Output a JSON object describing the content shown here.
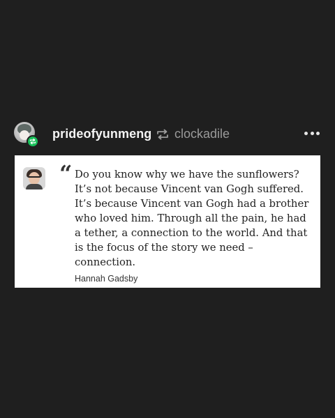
{
  "post": {
    "username": "prideofyunmeng",
    "reblogged_from": "clockadile",
    "avatar_icon": "reblog-badge-icon",
    "more_icon": "more-options-icon"
  },
  "quote": {
    "text": "Do you know why we have the sunflowers? It’s not because Vincent van Gogh suffered. It’s because Vincent van Gogh had a brother who loved him. Through all the pain, he had a tether, a connection to the world. And that is the focus of the story we need – connection.",
    "mark": "“",
    "author": "Hannah Gadsby"
  },
  "colors": {
    "background": "#1f1f1f",
    "reblog_badge": "#19c05a",
    "username": "#f4f4f4",
    "source": "#9a9a9a"
  }
}
